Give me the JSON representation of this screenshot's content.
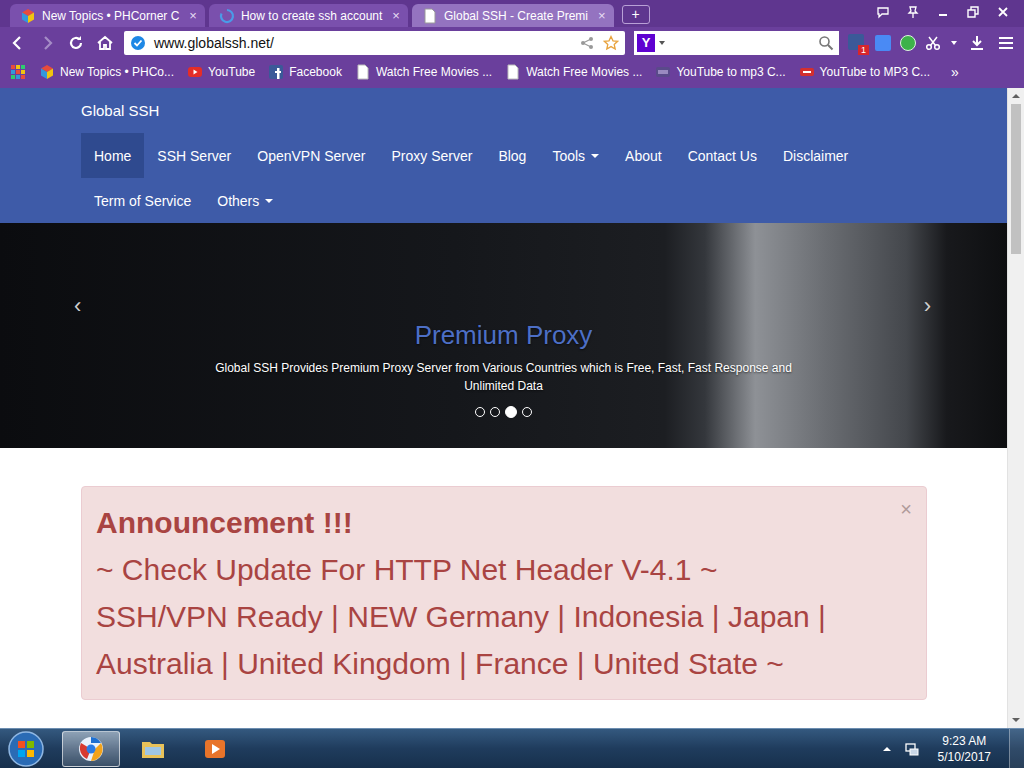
{
  "browser": {
    "tabs": [
      {
        "label": "New Topics • PHCorner C",
        "selected": false,
        "loading": false
      },
      {
        "label": "How to create ssh account",
        "selected": false,
        "loading": true
      },
      {
        "label": "Global SSH - Create Premi",
        "selected": true,
        "loading": false
      }
    ],
    "tab_close": "×",
    "new_tab": "+",
    "address": "www.globalssh.net/",
    "search_logo": "Y",
    "extension_badge": "1",
    "bookmarks": [
      {
        "label": "New Topics • PHCo...",
        "kind": "phc"
      },
      {
        "label": "YouTube",
        "kind": "youtube"
      },
      {
        "label": "Facebook",
        "kind": "facebook"
      },
      {
        "label": "Watch Free Movies ...",
        "kind": "page"
      },
      {
        "label": "Watch Free Movies ...",
        "kind": "page"
      },
      {
        "label": "YouTube to mp3 C...",
        "kind": "mp3"
      },
      {
        "label": "YouTube to MP3 C...",
        "kind": "ytmp3"
      }
    ],
    "bookmarks_more": "»"
  },
  "site": {
    "brand": "Global SSH",
    "nav": [
      {
        "label": "Home",
        "selected": true,
        "dropdown": false
      },
      {
        "label": "SSH Server",
        "selected": false,
        "dropdown": false
      },
      {
        "label": "OpenVPN Server",
        "selected": false,
        "dropdown": false
      },
      {
        "label": "Proxy Server",
        "selected": false,
        "dropdown": false
      },
      {
        "label": "Blog",
        "selected": false,
        "dropdown": false
      },
      {
        "label": "Tools",
        "selected": false,
        "dropdown": true
      },
      {
        "label": "About",
        "selected": false,
        "dropdown": false
      },
      {
        "label": "Contact Us",
        "selected": false,
        "dropdown": false
      },
      {
        "label": "Disclaimer",
        "selected": false,
        "dropdown": false
      },
      {
        "label": "Term of Service",
        "selected": false,
        "dropdown": false
      },
      {
        "label": "Others",
        "selected": false,
        "dropdown": true
      }
    ],
    "slide": {
      "title": "Premium Proxy",
      "text": "Global SSH Provides Premium Proxy Server from Various Countries which is Free, Fast, Fast Response and Unlimited Data",
      "prev": "‹",
      "next": "›",
      "indicators": [
        {
          "selected": false
        },
        {
          "selected": false
        },
        {
          "selected": true
        },
        {
          "selected": false
        }
      ]
    },
    "announcement": {
      "title": "Announcement !!!",
      "lines": [
        "~ Check Update For HTTP Net Header V-4.1 ~",
        "SSH/VPN Ready | NEW Germany | Indonesia | Japan | Australia | United Kingdom | France | United State ~"
      ],
      "close": "×"
    }
  },
  "taskbar": {
    "apps": [
      {
        "kind": "browser",
        "selected": true
      },
      {
        "kind": "explorer",
        "selected": false
      },
      {
        "kind": "media",
        "selected": false
      }
    ],
    "time": "9:23 AM",
    "date": "5/10/2017"
  }
}
